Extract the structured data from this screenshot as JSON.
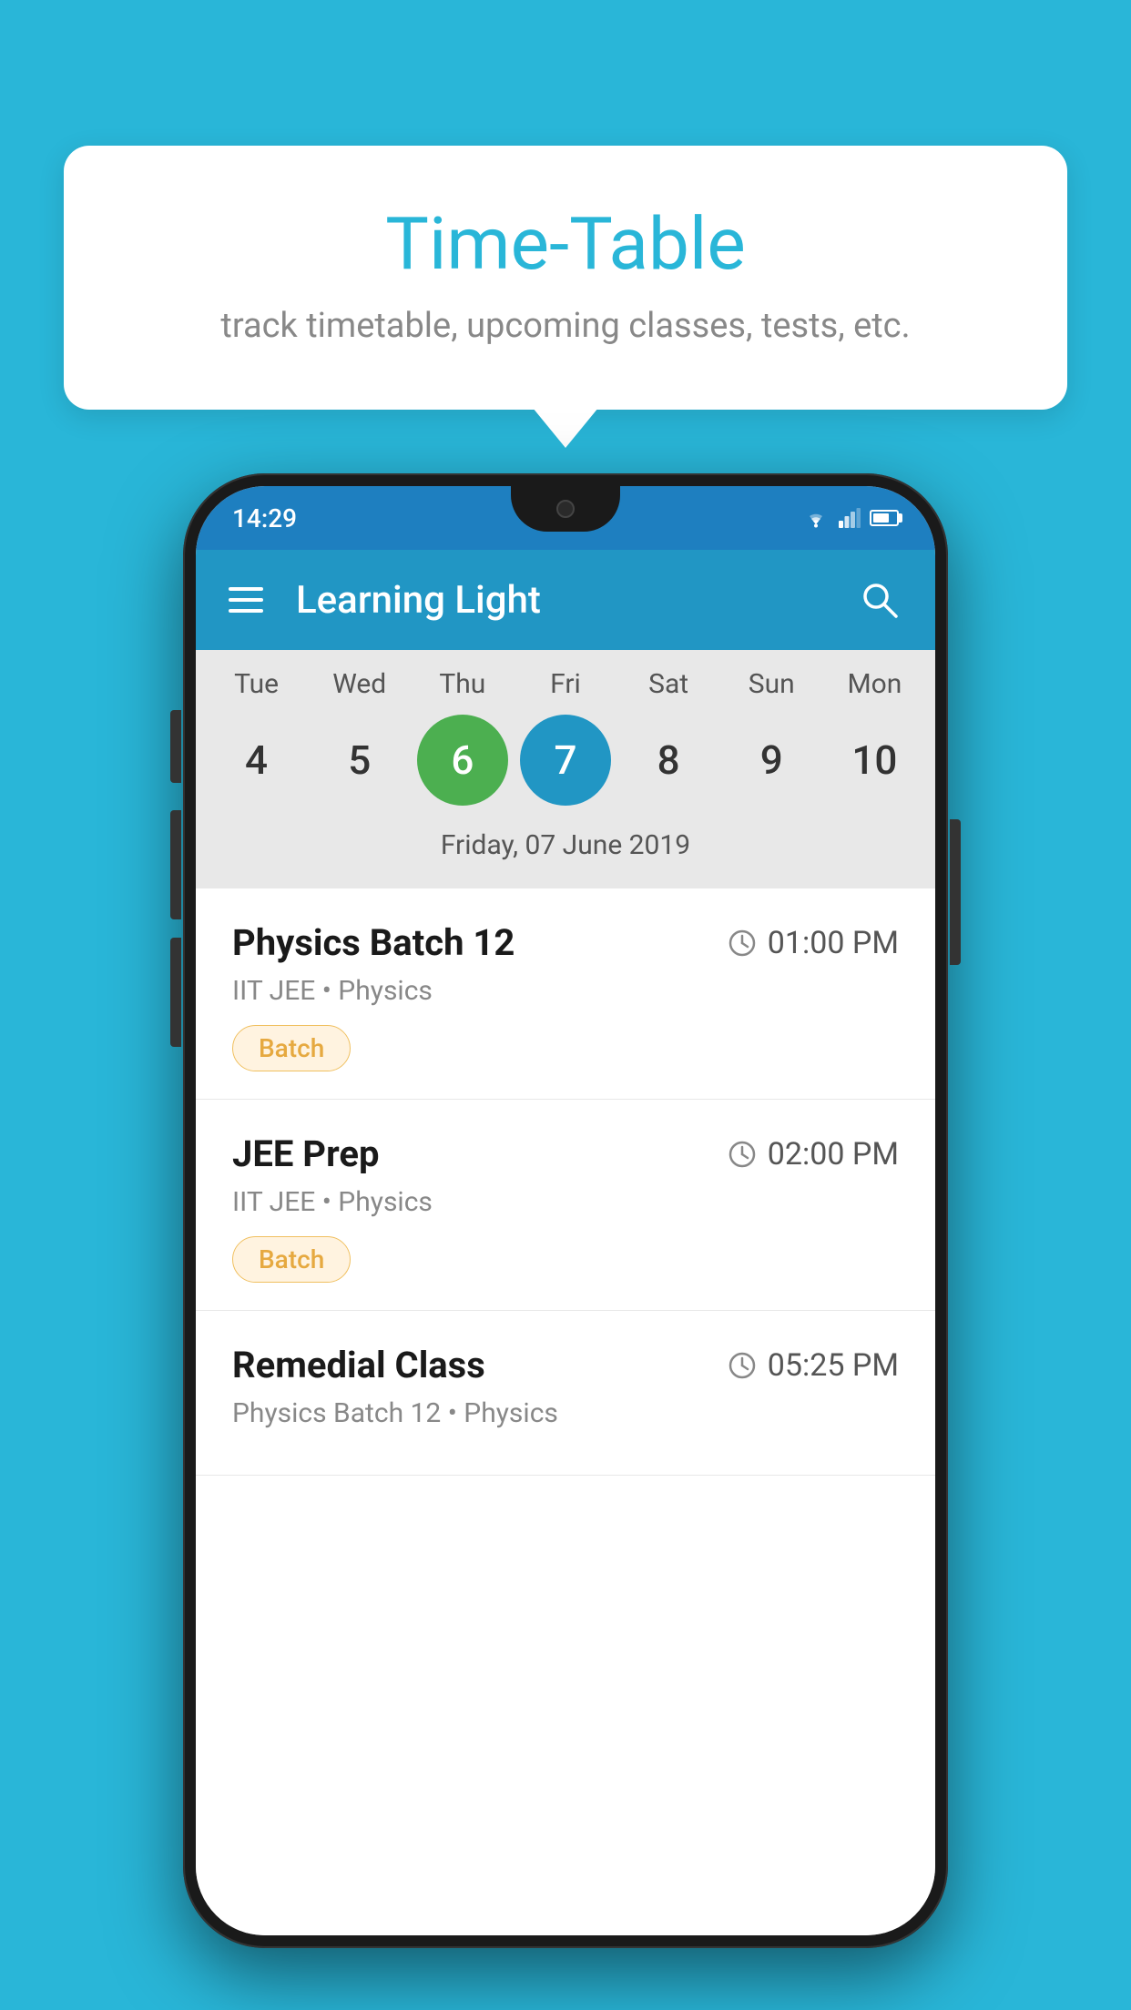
{
  "background": {
    "color": "#29b6d8"
  },
  "tooltip": {
    "title": "Time-Table",
    "subtitle": "track timetable, upcoming classes, tests, etc."
  },
  "phone": {
    "status_bar": {
      "time": "14:29"
    },
    "app_bar": {
      "title": "Learning Light"
    },
    "calendar": {
      "days": [
        "Tue",
        "Wed",
        "Thu",
        "Fri",
        "Sat",
        "Sun",
        "Mon"
      ],
      "numbers": [
        4,
        5,
        6,
        7,
        8,
        9,
        10
      ],
      "today_index": 2,
      "selected_index": 3,
      "selected_date_label": "Friday, 07 June 2019"
    },
    "schedule": [
      {
        "title": "Physics Batch 12",
        "time": "01:00 PM",
        "subtitle": "IIT JEE • Physics",
        "badge": "Batch"
      },
      {
        "title": "JEE Prep",
        "time": "02:00 PM",
        "subtitle": "IIT JEE • Physics",
        "badge": "Batch"
      },
      {
        "title": "Remedial Class",
        "time": "05:25 PM",
        "subtitle": "Physics Batch 12 • Physics",
        "badge": null
      }
    ]
  }
}
